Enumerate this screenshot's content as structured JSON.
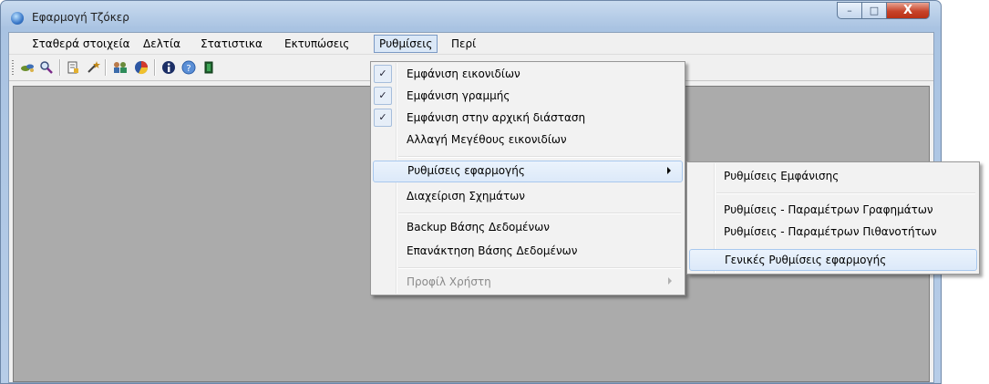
{
  "window": {
    "title": "Εφαρμογή Τζόκερ",
    "buttons": {
      "minimize": "–",
      "maximize": "□",
      "close": "X"
    }
  },
  "menubar": {
    "items": [
      {
        "label": "Σταθερά στοιχεία"
      },
      {
        "label": "Δελτία"
      },
      {
        "label": "Στατιστικα"
      },
      {
        "label": "Εκτυπώσεις"
      },
      {
        "label": "Ρυθμίσεις",
        "active": true
      },
      {
        "label": "Περί"
      }
    ]
  },
  "toolbar": {
    "icons": [
      "foot-icon",
      "magnifier-icon",
      "document-icon",
      "wand-icon",
      "people-icon",
      "chart-icon",
      "info-icon",
      "help-icon",
      "exit-icon"
    ]
  },
  "settings_menu": {
    "items": [
      {
        "label": "Εμφάνιση εικονιδίων",
        "checked": true
      },
      {
        "label": "Εμφάνιση γραμμής",
        "checked": true
      },
      {
        "label": "Εμφάνιση στην αρχική διάσταση",
        "checked": true
      },
      {
        "label": "Αλλαγή Μεγέθους εικονιδίων"
      },
      {
        "label": "Ρυθμίσεις εφαρμογής",
        "submenu": true,
        "highlighted": true
      },
      {
        "label": "Διαχείριση Σχημάτων"
      },
      {
        "label": "Backup Βάσης Δεδομένων"
      },
      {
        "label": "Επανάκτηση Βάσης Δεδομένων"
      },
      {
        "label": "Προφίλ Χρήστη",
        "submenu": true,
        "disabled": true
      }
    ],
    "check_glyph": "✓"
  },
  "app_settings_submenu": {
    "items": [
      {
        "label": "Ρυθμίσεις Εμφάνισης"
      },
      {
        "label": "Ρυθμίσεις - Παραμέτρων Γραφημάτων"
      },
      {
        "label": "Ρυθμίσεις - Παραμέτρων Πιθανοτήτων"
      },
      {
        "label": "Γενικές Ρυθμίσεις εφαρμογής",
        "highlighted": true
      }
    ]
  }
}
